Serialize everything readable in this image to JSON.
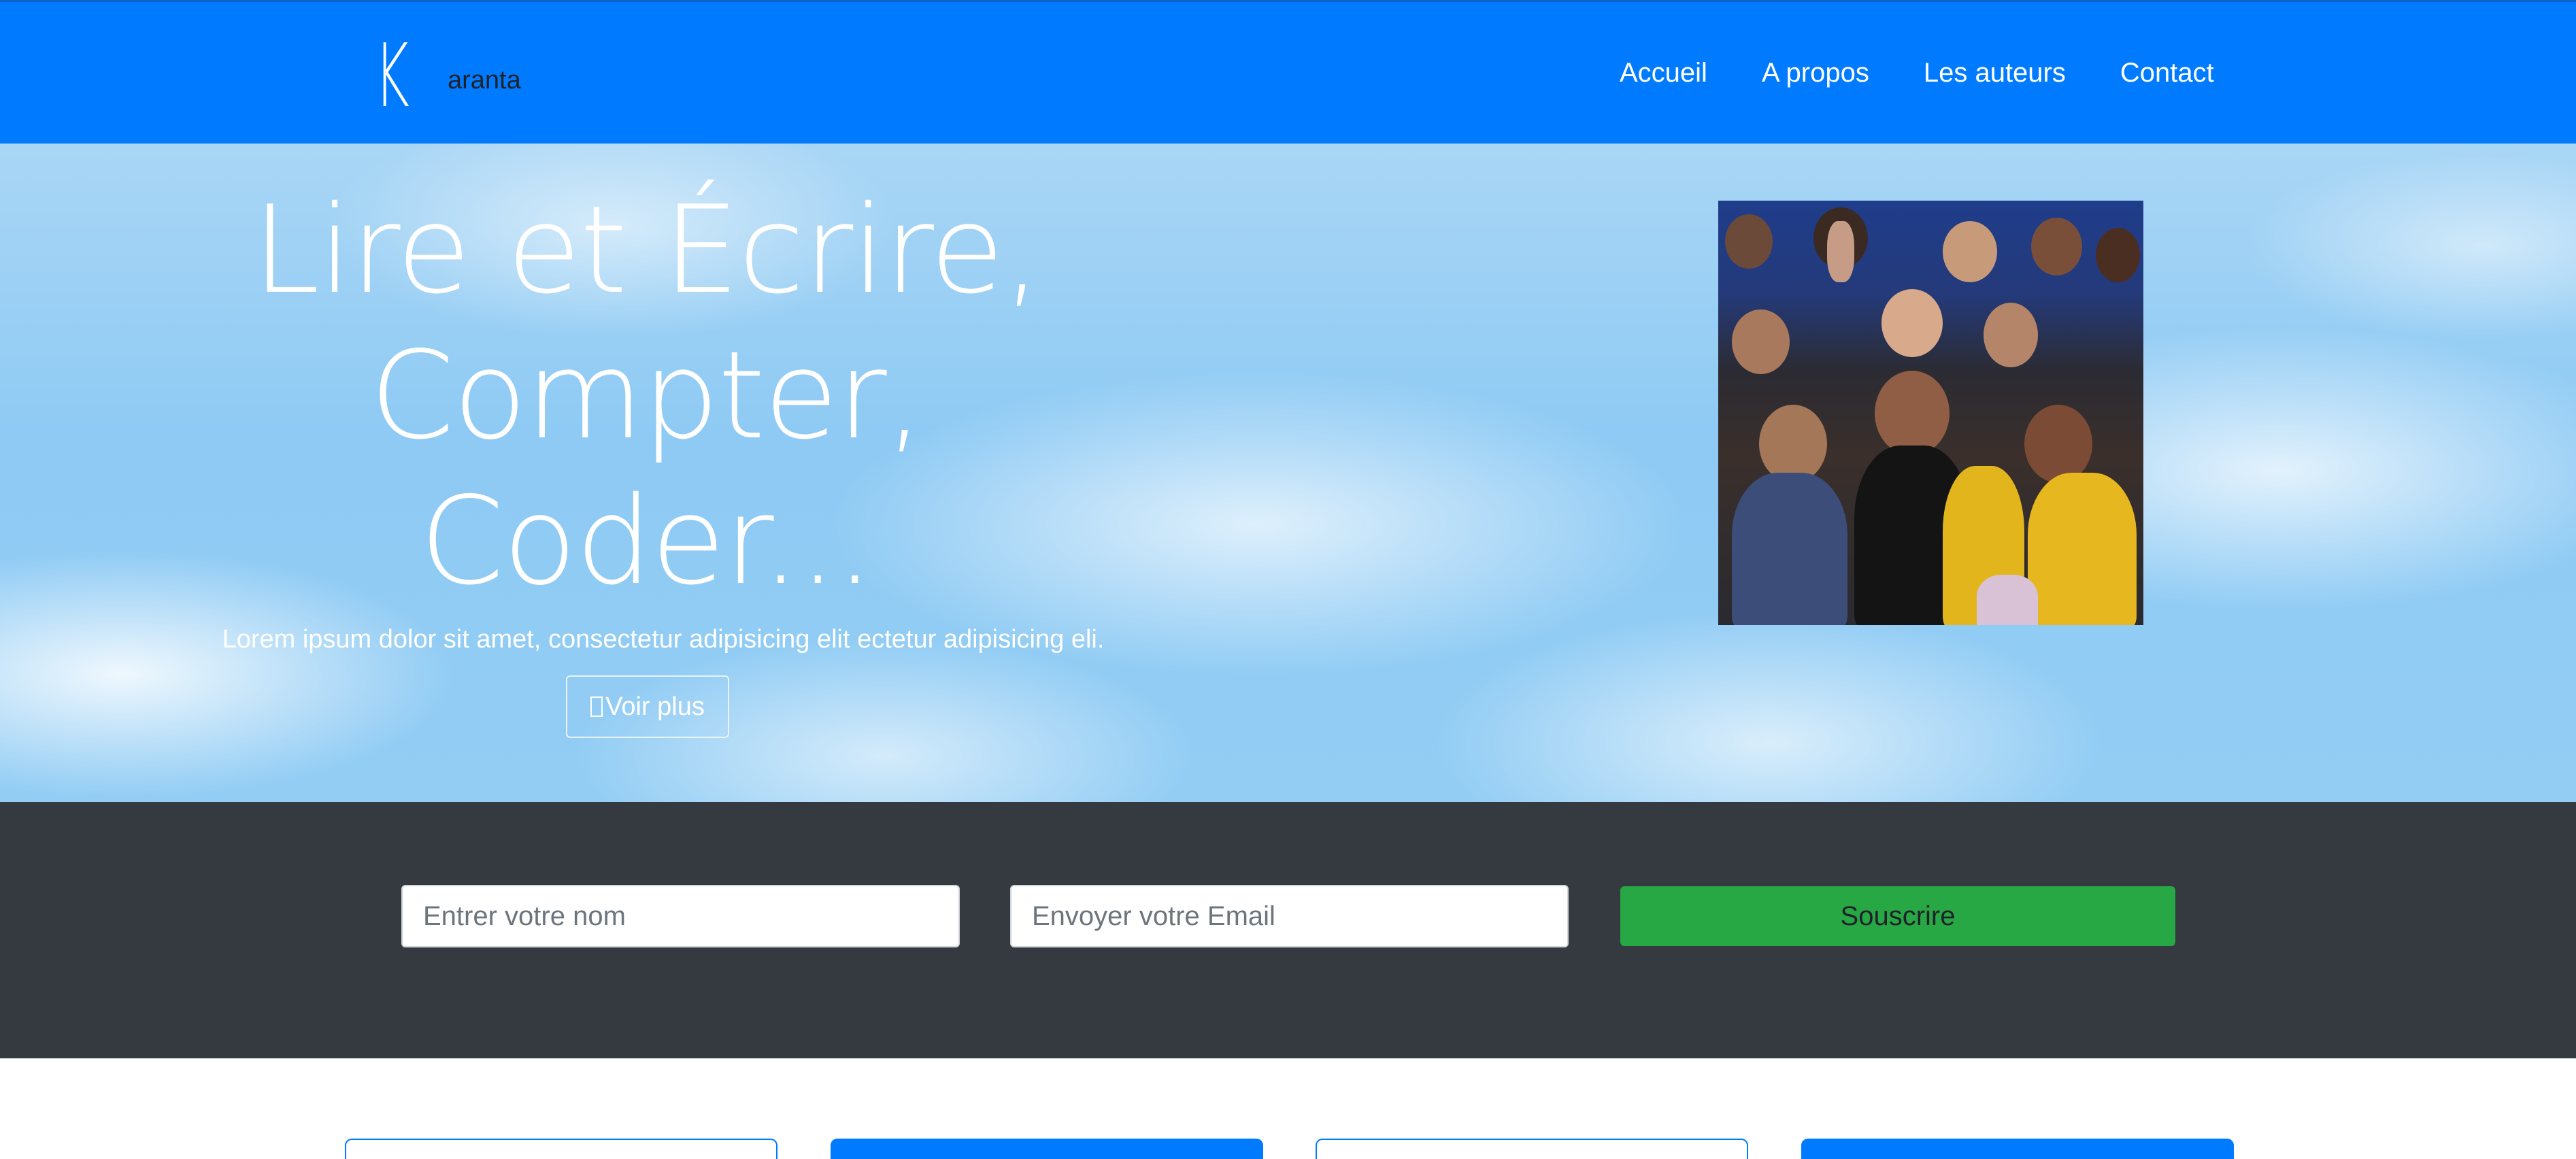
{
  "brand": {
    "letter": "K",
    "name": "aranta"
  },
  "nav": {
    "items": [
      "Accueil",
      "A propos",
      "Les auteurs",
      "Contact"
    ]
  },
  "hero": {
    "title_lines": [
      "Lire et Écrire,",
      "Compter,",
      "Coder..."
    ],
    "text": "Lorem ipsum dolor sit amet, consectetur adipisicing elit ectetur adipisicing eli.",
    "button_label": "Voir plus",
    "button_icon": "broken-glyph-icon"
  },
  "subscribe": {
    "name_placeholder": "Entrer votre nom",
    "email_placeholder": "Envoyer votre Email",
    "button_label": "Souscrire"
  },
  "colors": {
    "primary": "#007bff",
    "dark": "#343a40",
    "success": "#28a745"
  }
}
